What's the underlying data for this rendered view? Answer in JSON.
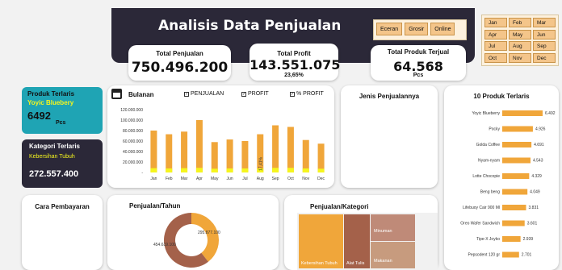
{
  "header": {
    "title": "Analisis Data Penjualan"
  },
  "slicer_jenis": [
    "Eceran",
    "Grosir",
    "Online"
  ],
  "slicer_bulan": [
    "Jan",
    "Feb",
    "Mar",
    "Apr",
    "May",
    "Jun",
    "Jul",
    "Aug",
    "Sep",
    "Oct",
    "Nov",
    "Dec"
  ],
  "kpi": {
    "penjualan": {
      "label": "Total Penjualan",
      "value": "750.496.200"
    },
    "profit": {
      "label": "Total Profit",
      "value": "143.551.075",
      "sub": "23,65%"
    },
    "produk": {
      "label": "Total Produk Terjual",
      "value": "64.568",
      "unit": "Pcs"
    }
  },
  "top_product": {
    "label": "Produk Terlaris",
    "name": "Yoyic Bluebery",
    "value": "6492",
    "unit": "Pcs"
  },
  "top_category": {
    "label": "Kategori Terlaris",
    "name": "Kebersihan Tubuh",
    "value": "272.557.400"
  },
  "monthly": {
    "title": "Bulanan",
    "legend": [
      "PENJUALAN",
      "PROFIT",
      "% PROFIT"
    ],
    "colors": {
      "penjualan": "#f0a63a",
      "profit": "#f5f51e"
    }
  },
  "jenis_title": "Jenis Penjualannya",
  "top10_title": "10 Produk Terlaris",
  "cara_title": "Cara Pembayaran",
  "tahun": {
    "title": "Penjualan/Tahun",
    "label_a": "295.877.100",
    "label_b": "454.619.100"
  },
  "kategori": {
    "title": "Penjualan/Kategori",
    "cells": [
      "Kebersihan Tubuh",
      "Alat Tulis",
      "Minuman",
      "Makanan"
    ]
  },
  "chart_data": [
    {
      "type": "bar",
      "title": "Bulanan",
      "categories": [
        "Jan",
        "Feb",
        "Mar",
        "Apr",
        "May",
        "Jun",
        "Jul",
        "Aug",
        "Sep",
        "Oct",
        "Nov",
        "Dec"
      ],
      "series": [
        {
          "name": "PENJUALAN",
          "values": [
            80000000,
            73000000,
            78000000,
            100000000,
            58000000,
            63000000,
            60000000,
            73000000,
            90000000,
            87000000,
            62000000,
            55000000
          ]
        },
        {
          "name": "PROFIT",
          "values": [
            15000000,
            14000000,
            15000000,
            16000000,
            13000000,
            14000000,
            14000000,
            14000000,
            16000000,
            16000000,
            14000000,
            13000000
          ]
        }
      ],
      "annotations": [
        "17,41%"
      ],
      "yticks": [
        "120.000.000",
        "100.000.000",
        "80.000.000",
        "60.000.000",
        "40.000.000",
        "20.000.000",
        "-"
      ],
      "ylim": [
        0,
        120000000
      ]
    },
    {
      "type": "bar",
      "title": "10 Produk Terlaris",
      "categories": [
        "Yoyic Blueberry",
        "Pocky",
        "Golda Coffee",
        "Nyam-nyam",
        "Lotte Chocopie",
        "Beng beng",
        "Lifebuoy Cair 900 Ml",
        "Oreo Wafer Sandwich",
        "Tipe-X Joyko",
        "Pepsodent 120 gr"
      ],
      "values": [
        6492,
        4926,
        4691,
        4543,
        4329,
        4049,
        3831,
        3601,
        2939,
        2701
      ],
      "labels": [
        "6.492",
        "4.926",
        "4.691",
        "4.543",
        "4.329",
        "4.049",
        "3.831",
        "3.601",
        "2.939",
        "2.701"
      ]
    },
    {
      "type": "pie",
      "title": "Penjualan/Tahun",
      "values": [
        295877100,
        454619100
      ],
      "labels": [
        "295.877.100",
        "454.619.100"
      ]
    }
  ]
}
